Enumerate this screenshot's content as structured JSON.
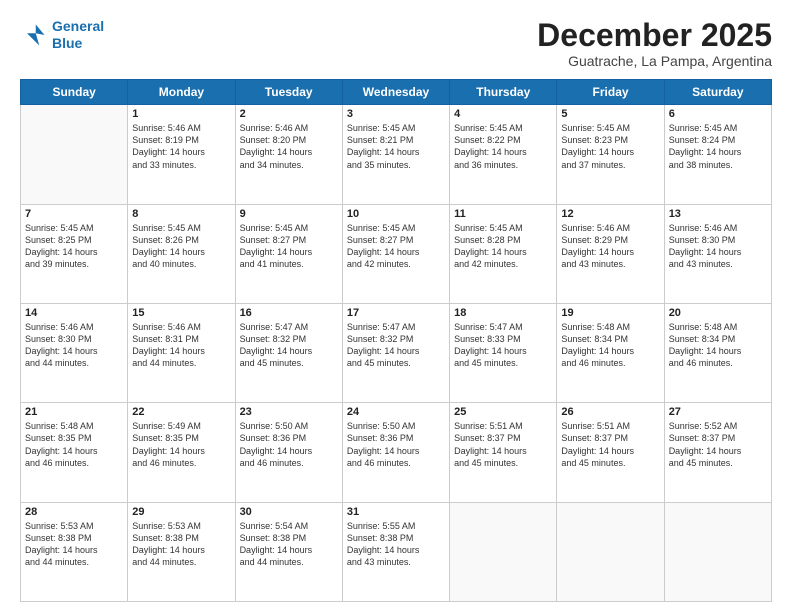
{
  "logo": {
    "line1": "General",
    "line2": "Blue"
  },
  "title": "December 2025",
  "subtitle": "Guatrache, La Pampa, Argentina",
  "weekdays": [
    "Sunday",
    "Monday",
    "Tuesday",
    "Wednesday",
    "Thursday",
    "Friday",
    "Saturday"
  ],
  "weeks": [
    [
      {
        "day": "",
        "info": ""
      },
      {
        "day": "1",
        "info": "Sunrise: 5:46 AM\nSunset: 8:19 PM\nDaylight: 14 hours\nand 33 minutes."
      },
      {
        "day": "2",
        "info": "Sunrise: 5:46 AM\nSunset: 8:20 PM\nDaylight: 14 hours\nand 34 minutes."
      },
      {
        "day": "3",
        "info": "Sunrise: 5:45 AM\nSunset: 8:21 PM\nDaylight: 14 hours\nand 35 minutes."
      },
      {
        "day": "4",
        "info": "Sunrise: 5:45 AM\nSunset: 8:22 PM\nDaylight: 14 hours\nand 36 minutes."
      },
      {
        "day": "5",
        "info": "Sunrise: 5:45 AM\nSunset: 8:23 PM\nDaylight: 14 hours\nand 37 minutes."
      },
      {
        "day": "6",
        "info": "Sunrise: 5:45 AM\nSunset: 8:24 PM\nDaylight: 14 hours\nand 38 minutes."
      }
    ],
    [
      {
        "day": "7",
        "info": "Sunrise: 5:45 AM\nSunset: 8:25 PM\nDaylight: 14 hours\nand 39 minutes."
      },
      {
        "day": "8",
        "info": "Sunrise: 5:45 AM\nSunset: 8:26 PM\nDaylight: 14 hours\nand 40 minutes."
      },
      {
        "day": "9",
        "info": "Sunrise: 5:45 AM\nSunset: 8:27 PM\nDaylight: 14 hours\nand 41 minutes."
      },
      {
        "day": "10",
        "info": "Sunrise: 5:45 AM\nSunset: 8:27 PM\nDaylight: 14 hours\nand 42 minutes."
      },
      {
        "day": "11",
        "info": "Sunrise: 5:45 AM\nSunset: 8:28 PM\nDaylight: 14 hours\nand 42 minutes."
      },
      {
        "day": "12",
        "info": "Sunrise: 5:46 AM\nSunset: 8:29 PM\nDaylight: 14 hours\nand 43 minutes."
      },
      {
        "day": "13",
        "info": "Sunrise: 5:46 AM\nSunset: 8:30 PM\nDaylight: 14 hours\nand 43 minutes."
      }
    ],
    [
      {
        "day": "14",
        "info": "Sunrise: 5:46 AM\nSunset: 8:30 PM\nDaylight: 14 hours\nand 44 minutes."
      },
      {
        "day": "15",
        "info": "Sunrise: 5:46 AM\nSunset: 8:31 PM\nDaylight: 14 hours\nand 44 minutes."
      },
      {
        "day": "16",
        "info": "Sunrise: 5:47 AM\nSunset: 8:32 PM\nDaylight: 14 hours\nand 45 minutes."
      },
      {
        "day": "17",
        "info": "Sunrise: 5:47 AM\nSunset: 8:32 PM\nDaylight: 14 hours\nand 45 minutes."
      },
      {
        "day": "18",
        "info": "Sunrise: 5:47 AM\nSunset: 8:33 PM\nDaylight: 14 hours\nand 45 minutes."
      },
      {
        "day": "19",
        "info": "Sunrise: 5:48 AM\nSunset: 8:34 PM\nDaylight: 14 hours\nand 46 minutes."
      },
      {
        "day": "20",
        "info": "Sunrise: 5:48 AM\nSunset: 8:34 PM\nDaylight: 14 hours\nand 46 minutes."
      }
    ],
    [
      {
        "day": "21",
        "info": "Sunrise: 5:48 AM\nSunset: 8:35 PM\nDaylight: 14 hours\nand 46 minutes."
      },
      {
        "day": "22",
        "info": "Sunrise: 5:49 AM\nSunset: 8:35 PM\nDaylight: 14 hours\nand 46 minutes."
      },
      {
        "day": "23",
        "info": "Sunrise: 5:50 AM\nSunset: 8:36 PM\nDaylight: 14 hours\nand 46 minutes."
      },
      {
        "day": "24",
        "info": "Sunrise: 5:50 AM\nSunset: 8:36 PM\nDaylight: 14 hours\nand 46 minutes."
      },
      {
        "day": "25",
        "info": "Sunrise: 5:51 AM\nSunset: 8:37 PM\nDaylight: 14 hours\nand 45 minutes."
      },
      {
        "day": "26",
        "info": "Sunrise: 5:51 AM\nSunset: 8:37 PM\nDaylight: 14 hours\nand 45 minutes."
      },
      {
        "day": "27",
        "info": "Sunrise: 5:52 AM\nSunset: 8:37 PM\nDaylight: 14 hours\nand 45 minutes."
      }
    ],
    [
      {
        "day": "28",
        "info": "Sunrise: 5:53 AM\nSunset: 8:38 PM\nDaylight: 14 hours\nand 44 minutes."
      },
      {
        "day": "29",
        "info": "Sunrise: 5:53 AM\nSunset: 8:38 PM\nDaylight: 14 hours\nand 44 minutes."
      },
      {
        "day": "30",
        "info": "Sunrise: 5:54 AM\nSunset: 8:38 PM\nDaylight: 14 hours\nand 44 minutes."
      },
      {
        "day": "31",
        "info": "Sunrise: 5:55 AM\nSunset: 8:38 PM\nDaylight: 14 hours\nand 43 minutes."
      },
      {
        "day": "",
        "info": ""
      },
      {
        "day": "",
        "info": ""
      },
      {
        "day": "",
        "info": ""
      }
    ]
  ]
}
